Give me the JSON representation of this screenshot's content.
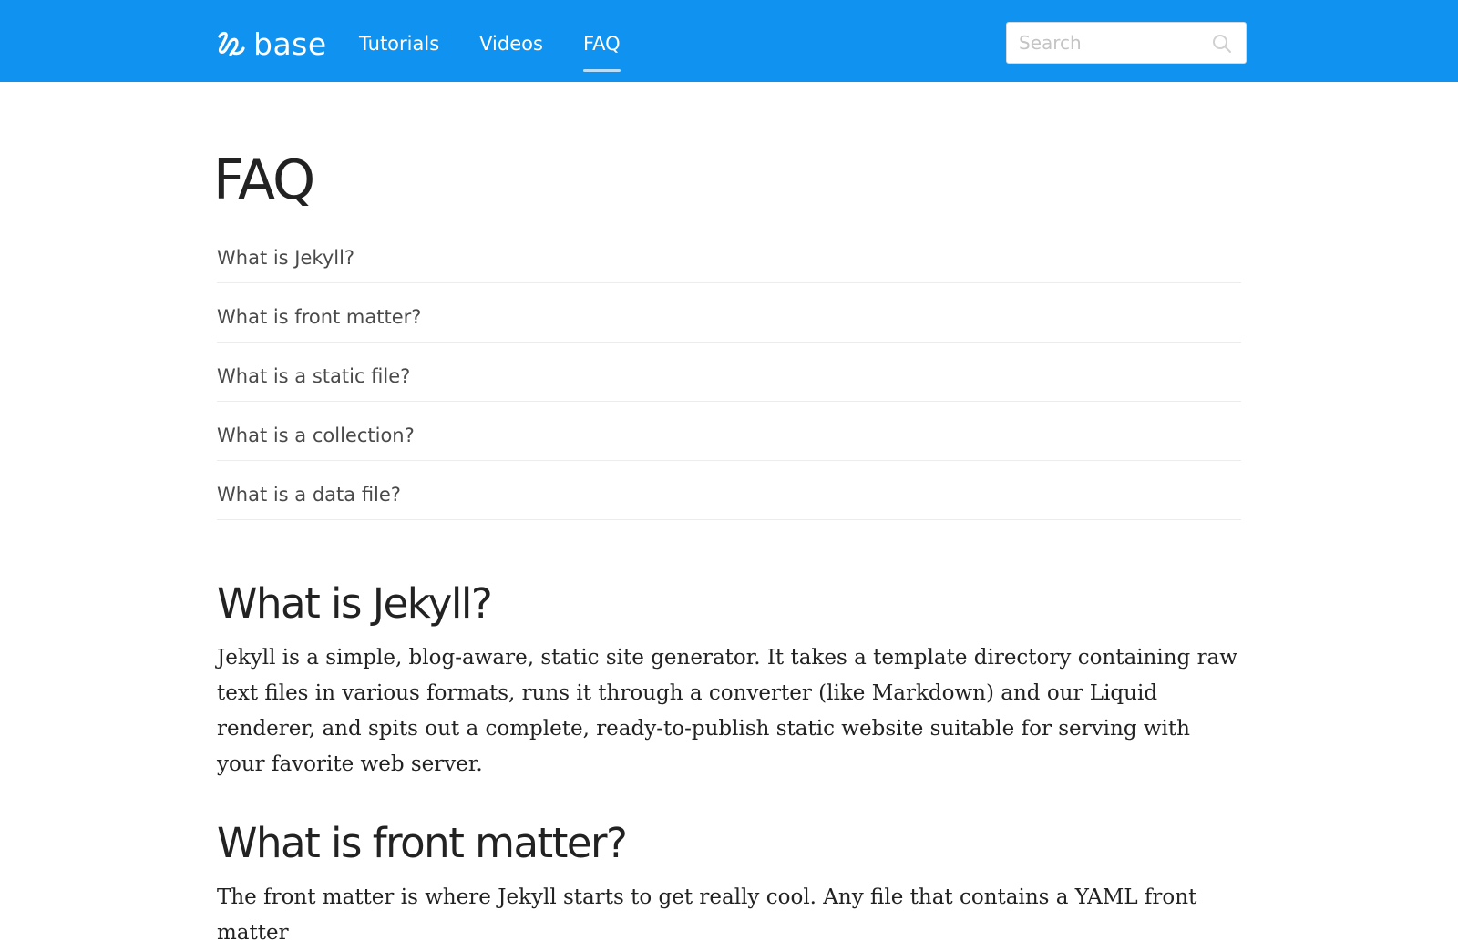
{
  "header": {
    "logo_text": "base",
    "logo_icon": "base-logo-icon",
    "nav": [
      {
        "label": "Tutorials",
        "active": false
      },
      {
        "label": "Videos",
        "active": false
      },
      {
        "label": "FAQ",
        "active": true
      }
    ],
    "search": {
      "placeholder": "Search",
      "value": "",
      "icon": "search-icon"
    }
  },
  "colors": {
    "header_bg": "#1093f0",
    "text": "#222222",
    "toc_text": "#4a4a4a",
    "divider": "#ececec"
  },
  "main": {
    "title": "FAQ",
    "toc": [
      "What is Jekyll?",
      "What is front matter?",
      "What is a static file?",
      "What is a collection?",
      "What is a data file?"
    ],
    "sections": [
      {
        "title": "What is Jekyll?",
        "body": "Jekyll is a simple, blog-aware, static site generator. It takes a template directory containing raw text files in various formats, runs it through a converter (like Markdown) and our Liquid renderer, and spits out a complete, ready-to-publish static website suitable for serving with your favorite web server."
      },
      {
        "title": "What is front matter?",
        "body": "The front matter is where Jekyll starts to get really cool. Any file that contains a YAML front matter"
      }
    ]
  }
}
